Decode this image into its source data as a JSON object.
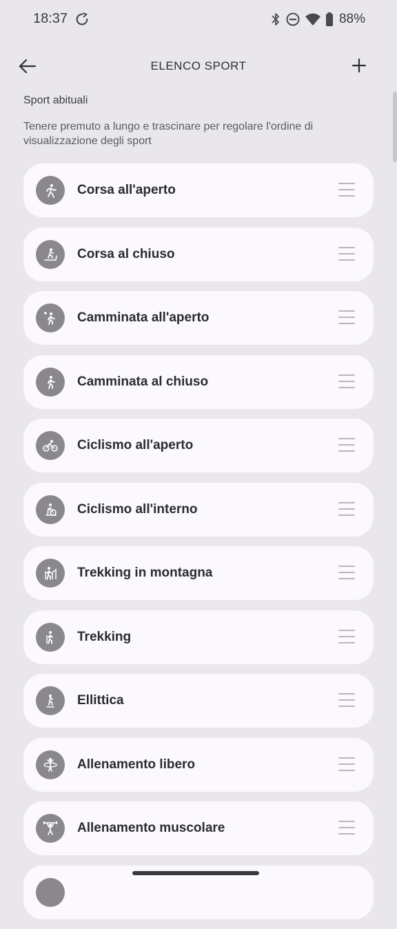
{
  "status_bar": {
    "time": "18:37",
    "battery": "88%",
    "icons": [
      "sync-icon",
      "bluetooth-icon",
      "do-not-disturb-icon",
      "wifi-icon",
      "battery-icon"
    ]
  },
  "header": {
    "title": "ELENCO SPORT",
    "back_icon": "arrow-left-icon",
    "add_icon": "plus-icon"
  },
  "section": {
    "title": "Sport abituali",
    "hint": "Tenere premuto a lungo e trascinare per regolare l'ordine di visualizzazione degli sport"
  },
  "sports": [
    {
      "label": "Corsa all'aperto",
      "icon": "run-icon"
    },
    {
      "label": "Corsa al chiuso",
      "icon": "treadmill-icon"
    },
    {
      "label": "Camminata all'aperto",
      "icon": "walk-outdoor-icon"
    },
    {
      "label": "Camminata al chiuso",
      "icon": "walk-indoor-icon"
    },
    {
      "label": "Ciclismo all'aperto",
      "icon": "bike-icon"
    },
    {
      "label": "Ciclismo all'interno",
      "icon": "indoor-bike-icon"
    },
    {
      "label": "Trekking in montagna",
      "icon": "mountain-hike-icon"
    },
    {
      "label": "Trekking",
      "icon": "trekking-icon"
    },
    {
      "label": "Ellittica",
      "icon": "elliptical-icon"
    },
    {
      "label": "Allenamento libero",
      "icon": "hula-hoop-icon"
    },
    {
      "label": "Allenamento muscolare",
      "icon": "weightlifting-icon"
    },
    {
      "label": "",
      "icon": "sport-icon"
    }
  ],
  "colors": {
    "background": "#e9e7ec",
    "card": "#fbf9fd",
    "icon_circle": "#8a888d",
    "text": "#2b2b2e"
  }
}
